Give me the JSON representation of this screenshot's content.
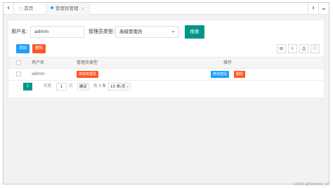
{
  "tabs": {
    "home_label": "首页",
    "active_label": "管理员管理",
    "close_glyph": "×",
    "nav_left_glyph": "‹",
    "nav_right_glyph": "›",
    "menu_glyph": "⌄"
  },
  "search": {
    "username_label": "用户名:",
    "username_value": "admin",
    "type_label": "管理员类型:",
    "type_value": "高级管理员",
    "search_button": "搜索"
  },
  "toolbar": {
    "add_label": "添加",
    "delete_label": "删除",
    "icons": [
      "filter-icon",
      "export-icon",
      "print-icon",
      "info-icon"
    ],
    "icon_glyphs": [
      "⊞",
      "⇩",
      "⎙",
      "ⓘ"
    ]
  },
  "table": {
    "headers": {
      "username": "用户名",
      "type": "管理员类型",
      "op": "操作"
    },
    "rows": [
      {
        "username": "admin",
        "type": "高级管理员",
        "edit": "修改密码",
        "remove": "删除"
      }
    ]
  },
  "pager": {
    "prev": "‹",
    "current": "1",
    "next": "›",
    "goto_label": "到第",
    "page_input": "1",
    "page_label": "页",
    "confirm": "确定",
    "total": "共 1 条",
    "size": "15 条/页"
  },
  "watermark": "CSDN @Rainbow_Qi",
  "colors": {
    "primary": "#009688",
    "blue": "#1e9fff",
    "danger": "#ff5722"
  }
}
